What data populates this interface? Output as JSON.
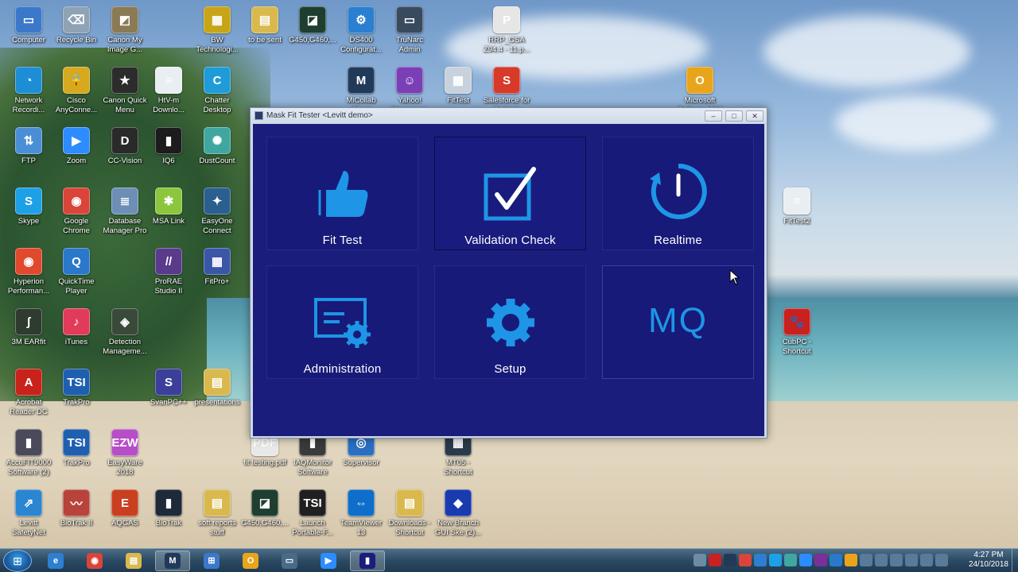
{
  "window": {
    "title": "Mask Fit Tester <Levitt demo>",
    "controls": {
      "minimize": "–",
      "maximize": "□",
      "close": "✕"
    }
  },
  "tiles": [
    {
      "label": "Fit Test",
      "icon": "thumbs-up-icon"
    },
    {
      "label": "Validation Check",
      "icon": "checkbox-icon"
    },
    {
      "label": "Realtime",
      "icon": "timer-icon"
    },
    {
      "label": "Administration",
      "icon": "certificate-gear-icon"
    },
    {
      "label": "Setup",
      "icon": "gear-icon"
    },
    {
      "label": "",
      "icon": "mq-text-icon",
      "text": "MQ"
    }
  ],
  "desktop_icons": [
    {
      "label": "Computer",
      "color": "#3b78c9",
      "glyph": "▭"
    },
    {
      "label": "Recycle Bin",
      "color": "#8fa3b5",
      "glyph": "⌫"
    },
    {
      "label": "Canon My\nImage G...",
      "color": "#8a7a55",
      "glyph": "◩"
    },
    {
      "label": "BW\nTechnologi...",
      "color": "#c7a516",
      "glyph": "▦"
    },
    {
      "label": "to be sent",
      "color": "#d9b94e",
      "glyph": "▤"
    },
    {
      "label": "G450,G460,...",
      "color": "#1e3f2f",
      "glyph": "◪"
    },
    {
      "label": "DS400\nConfigurat...",
      "color": "#2a7fd0",
      "glyph": "⚙"
    },
    {
      "label": "TruNarc\nAdmin",
      "color": "#3a4a5e",
      "glyph": "▭"
    },
    {
      "label": "RRP_GSA\nZ94.4 - 11.p...",
      "color": "#e6e6e6",
      "glyph": "P"
    },
    {
      "label": "Network\nRecordi...",
      "color": "#1d8ed6",
      "glyph": "◔"
    },
    {
      "label": "Cisco\nAnyConne...",
      "color": "#d6a91e",
      "glyph": "🔒"
    },
    {
      "label": "Canon Quick\nMenu",
      "color": "#2c2c2c",
      "glyph": "★"
    },
    {
      "label": "HtV-m\nDownlo...",
      "color": "#e8eef2",
      "glyph": "≡"
    },
    {
      "label": "Chatter\nDesktop",
      "color": "#1f9bd8",
      "glyph": "C"
    },
    {
      "label": "MiCollab\nClient",
      "color": "#223a5a",
      "glyph": "M"
    },
    {
      "label": "Yahoo!\nMessenger",
      "color": "#7a3fb5",
      "glyph": "☺"
    },
    {
      "label": "FitTest",
      "color": "#c8d2dc",
      "glyph": "▦"
    },
    {
      "label": "Salesforce for\nOutlook",
      "color": "#d83a2a",
      "glyph": "S"
    },
    {
      "label": "Microsoft\nOutlook 2010",
      "color": "#e8a51c",
      "glyph": "O"
    },
    {
      "label": "FTP",
      "color": "#4a8fd6",
      "glyph": "⇅"
    },
    {
      "label": "Zoom",
      "color": "#2d8cff",
      "glyph": "▶"
    },
    {
      "label": "CC-Vision",
      "color": "#2a2a2a",
      "glyph": "D"
    },
    {
      "label": "IQ6",
      "color": "#1c1c1c",
      "glyph": "▮"
    },
    {
      "label": "DustCount",
      "color": "#3fa7a0",
      "glyph": "✺"
    },
    {
      "label": "Skype",
      "color": "#1ea0e6",
      "glyph": "S"
    },
    {
      "label": "Google\nChrome",
      "color": "#d9453a",
      "glyph": "◉"
    },
    {
      "label": "Database\nManager Pro",
      "color": "#6d8fb5",
      "glyph": "≣"
    },
    {
      "label": "MSA Link",
      "color": "#8cc63f",
      "glyph": "✱"
    },
    {
      "label": "EasyOne\nConnect",
      "color": "#2b5f8f",
      "glyph": "✦"
    },
    {
      "label": "Hyperion\nPerforman...",
      "color": "#e0492d",
      "glyph": "◉"
    },
    {
      "label": "QuickTime\nPlayer",
      "color": "#2a78c9",
      "glyph": "Q"
    },
    {
      "label": "ProRAE\nStudio II",
      "color": "#5a3a8a",
      "glyph": "//"
    },
    {
      "label": "FitPro+",
      "color": "#3a56a6",
      "glyph": "▦"
    },
    {
      "label": "3M EARfit",
      "color": "#2e3b2e",
      "glyph": "ʃ"
    },
    {
      "label": "iTunes",
      "color": "#e23b5a",
      "glyph": "♪"
    },
    {
      "label": "Detection\nManageme...",
      "color": "#3a4a3a",
      "glyph": "◈"
    },
    {
      "label": "Acrobat\nReader DC",
      "color": "#c9221b",
      "glyph": "A"
    },
    {
      "label": "TrakPro",
      "color": "#1f5fb0",
      "glyph": "TSI"
    },
    {
      "label": "SvanPC++",
      "color": "#3b3f9a",
      "glyph": "S"
    },
    {
      "label": "presentations",
      "color": "#d9b94e",
      "glyph": "▤"
    },
    {
      "label": "AccuFIT9000\nSoftware (2)",
      "color": "#4a4a5a",
      "glyph": "▮"
    },
    {
      "label": "TrakPro",
      "color": "#1f5fb0",
      "glyph": "TSI"
    },
    {
      "label": "EasyWare\n2018",
      "color": "#b64ec7",
      "glyph": "EZW"
    },
    {
      "label": "fit testing.pdf",
      "color": "#e8e8e8",
      "glyph": "PDF"
    },
    {
      "label": "IAQMonitor\nSoftware",
      "color": "#3a3a3a",
      "glyph": "▮"
    },
    {
      "label": "Supervisor",
      "color": "#2a6fc0",
      "glyph": "◎"
    },
    {
      "label": "MT05 -\nShortcut",
      "color": "#2a3a4a",
      "glyph": "▦"
    },
    {
      "label": "Levitt\nSafetyNet",
      "color": "#2a86d0",
      "glyph": "⇗"
    },
    {
      "label": "BioTrak II",
      "color": "#b8433a",
      "glyph": "〰"
    },
    {
      "label": "AQGAS",
      "color": "#c94020",
      "glyph": "E"
    },
    {
      "label": "BioTrak",
      "color": "#1e2a3a",
      "glyph": "▮"
    },
    {
      "label": "soft reports\nstuff",
      "color": "#d9b94e",
      "glyph": "▤"
    },
    {
      "label": "G450,G460,...",
      "color": "#1e3f2f",
      "glyph": "◪"
    },
    {
      "label": "Launch\nPortable-F...",
      "color": "#202020",
      "glyph": "TSI"
    },
    {
      "label": "TeamViewer\n13",
      "color": "#0e6ec9",
      "glyph": "⇔"
    },
    {
      "label": "Downloads -\nShortcut",
      "color": "#d9b94e",
      "glyph": "▤"
    },
    {
      "label": "New Branch\nGUI Ske (2)...",
      "color": "#1a3ab0",
      "glyph": "◆"
    },
    {
      "label": "FitTest2",
      "color": "#e8eef2",
      "glyph": "≡"
    },
    {
      "label": "CubPC -\nShortcut",
      "color": "#c92020",
      "glyph": "🐾"
    }
  ],
  "taskbar": {
    "start": "⊞",
    "apps": [
      {
        "name": "internet-explorer",
        "color": "#2d7fd0",
        "glyph": "e"
      },
      {
        "name": "chrome",
        "color": "#d9453a",
        "glyph": "◉"
      },
      {
        "name": "explorer",
        "color": "#d9b94e",
        "glyph": "▤"
      },
      {
        "name": "micollab",
        "color": "#223a5a",
        "glyph": "M"
      },
      {
        "name": "network-app",
        "color": "#3b78c9",
        "glyph": "⊞"
      },
      {
        "name": "outlook",
        "color": "#e8a51c",
        "glyph": "O"
      },
      {
        "name": "screen-app",
        "color": "#4a6a8a",
        "glyph": "▭"
      },
      {
        "name": "zoom",
        "color": "#2d8cff",
        "glyph": "▶"
      },
      {
        "name": "mask-fit-tester",
        "color": "#1b1d7c",
        "glyph": "▮"
      }
    ],
    "time": "4:27 PM",
    "date": "24/10/2018"
  }
}
